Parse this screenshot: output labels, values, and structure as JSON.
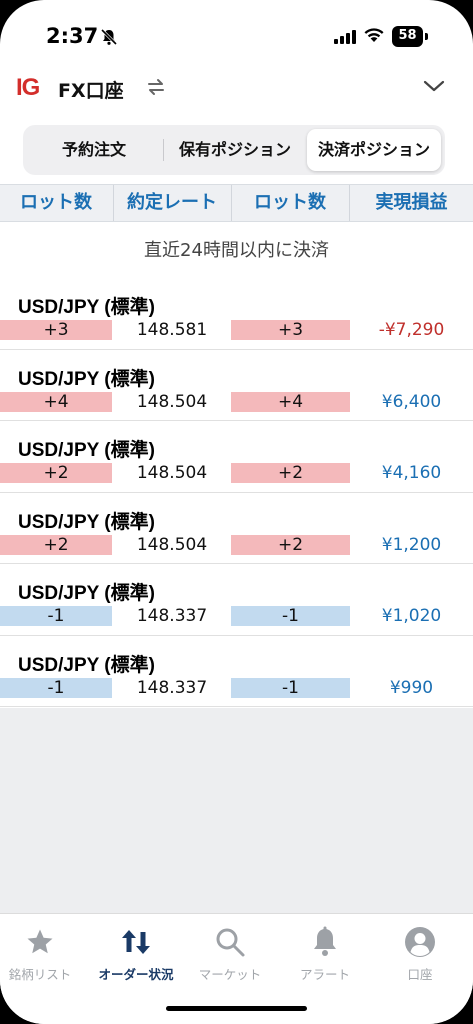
{
  "status_bar": {
    "time": "2:37",
    "battery": "58"
  },
  "header": {
    "logo": "IG",
    "account": "FX口座"
  },
  "segments": [
    "予約注文",
    "保有ポジション",
    "決済ポジション"
  ],
  "columns": [
    "ロット数",
    "約定レート",
    "ロット数",
    "実現損益"
  ],
  "note": "直近24時間以内に決済",
  "rows": [
    {
      "symbol": "USD/JPY (標準)",
      "lot": "+3",
      "rate": "148.581",
      "lot2": "+3",
      "pnl": "-¥7,290",
      "side": "buy",
      "pnl_sign": "neg"
    },
    {
      "symbol": "USD/JPY (標準)",
      "lot": "+4",
      "rate": "148.504",
      "lot2": "+4",
      "pnl": "¥6,400",
      "side": "buy",
      "pnl_sign": "pos"
    },
    {
      "symbol": "USD/JPY (標準)",
      "lot": "+2",
      "rate": "148.504",
      "lot2": "+2",
      "pnl": "¥4,160",
      "side": "buy",
      "pnl_sign": "pos"
    },
    {
      "symbol": "USD/JPY (標準)",
      "lot": "+2",
      "rate": "148.504",
      "lot2": "+2",
      "pnl": "¥1,200",
      "side": "buy",
      "pnl_sign": "pos"
    },
    {
      "symbol": "USD/JPY (標準)",
      "lot": "-1",
      "rate": "148.337",
      "lot2": "-1",
      "pnl": "¥1,020",
      "side": "sell",
      "pnl_sign": "pos"
    },
    {
      "symbol": "USD/JPY (標準)",
      "lot": "-1",
      "rate": "148.337",
      "lot2": "-1",
      "pnl": "¥990",
      "side": "sell",
      "pnl_sign": "pos"
    }
  ],
  "tabs": [
    {
      "label": "銘柄リスト",
      "icon": "star-icon"
    },
    {
      "label": "オーダー状況",
      "icon": "order-arrows-icon",
      "active": true
    },
    {
      "label": "マーケット",
      "icon": "search-icon"
    },
    {
      "label": "アラート",
      "icon": "bell-icon"
    },
    {
      "label": "口座",
      "icon": "account-icon"
    }
  ],
  "colors": {
    "buy": "#f4b9bb",
    "sell": "#c2daef",
    "positive": "#1b6fb3",
    "negative": "#c0302c",
    "brand": "#d32e2b"
  }
}
